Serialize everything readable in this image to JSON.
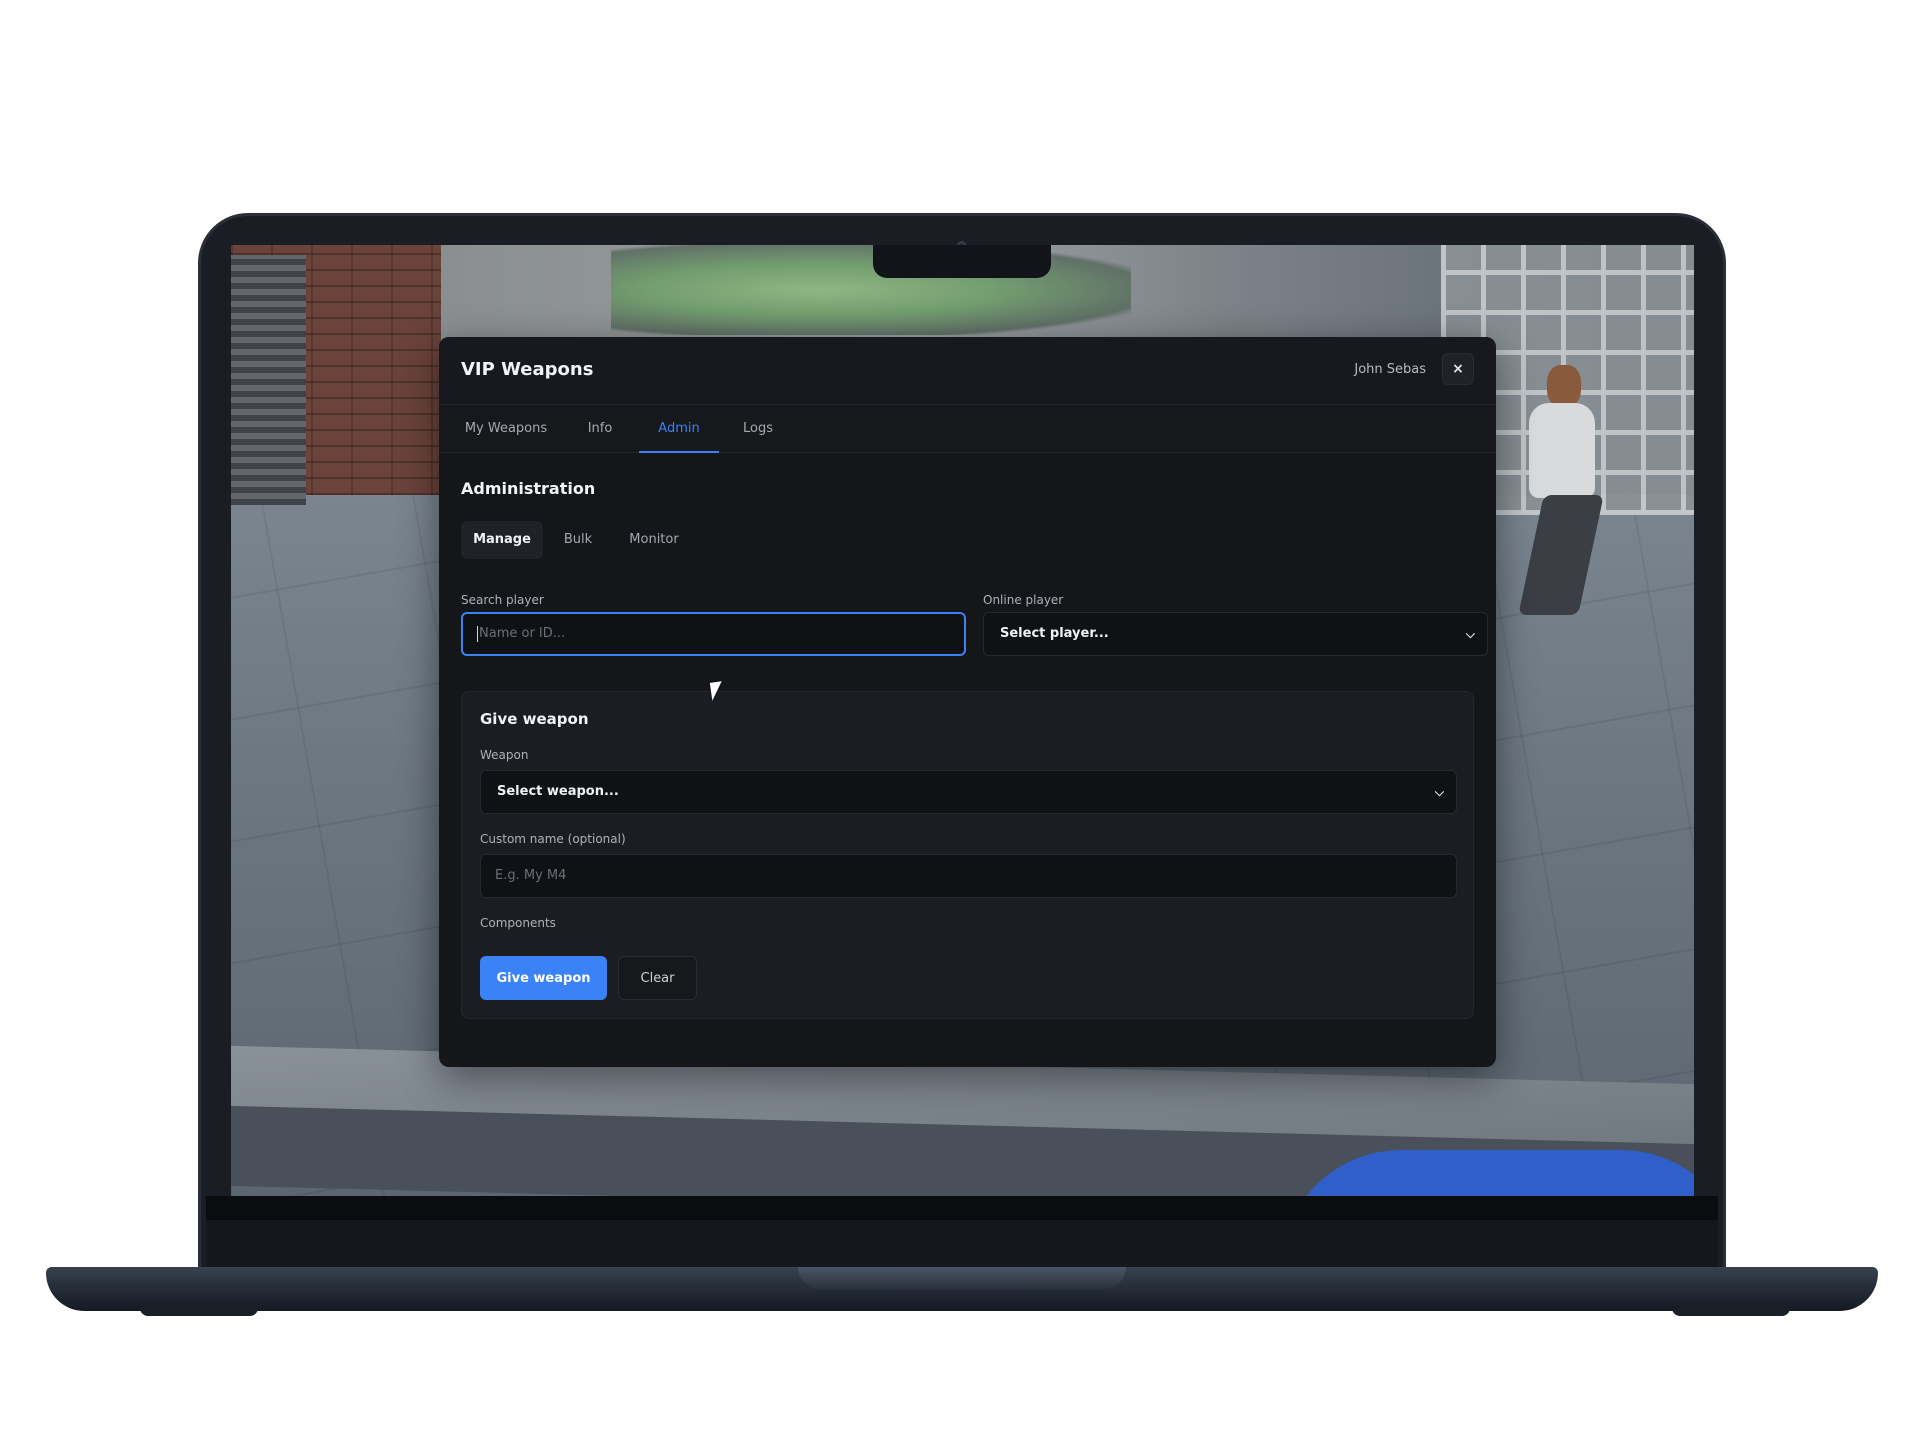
{
  "app": {
    "title": "VIP Weapons",
    "user_name": "John Sebas",
    "close_icon": "×"
  },
  "tabs": [
    {
      "label": "My Weapons",
      "active": false
    },
    {
      "label": "Info",
      "active": false
    },
    {
      "label": "Admin",
      "active": true
    },
    {
      "label": "Logs",
      "active": false
    }
  ],
  "admin": {
    "section_title": "Administration",
    "subtabs": [
      {
        "label": "Manage",
        "active": true
      },
      {
        "label": "Bulk",
        "active": false
      },
      {
        "label": "Monitor",
        "active": false
      }
    ],
    "search": {
      "label": "Search player",
      "placeholder": "Name or ID...",
      "value": ""
    },
    "online": {
      "label": "Online player",
      "selected": "Select player..."
    },
    "give_weapon": {
      "title": "Give weapon",
      "weapon_label": "Weapon",
      "weapon_selected": "Select weapon...",
      "custom_name_label": "Custom name (optional)",
      "custom_name_placeholder": "E.g. My M4",
      "components_label": "Components",
      "give_button": "Give weapon",
      "clear_button": "Clear"
    }
  },
  "icons": {
    "close": "close-icon",
    "chevron": "chevron-down-icon",
    "cursor": "mouse-pointer-icon"
  },
  "colors": {
    "accent": "#3b82f6",
    "panel_bg": "#15161a",
    "card_bg": "#1c1d22"
  }
}
